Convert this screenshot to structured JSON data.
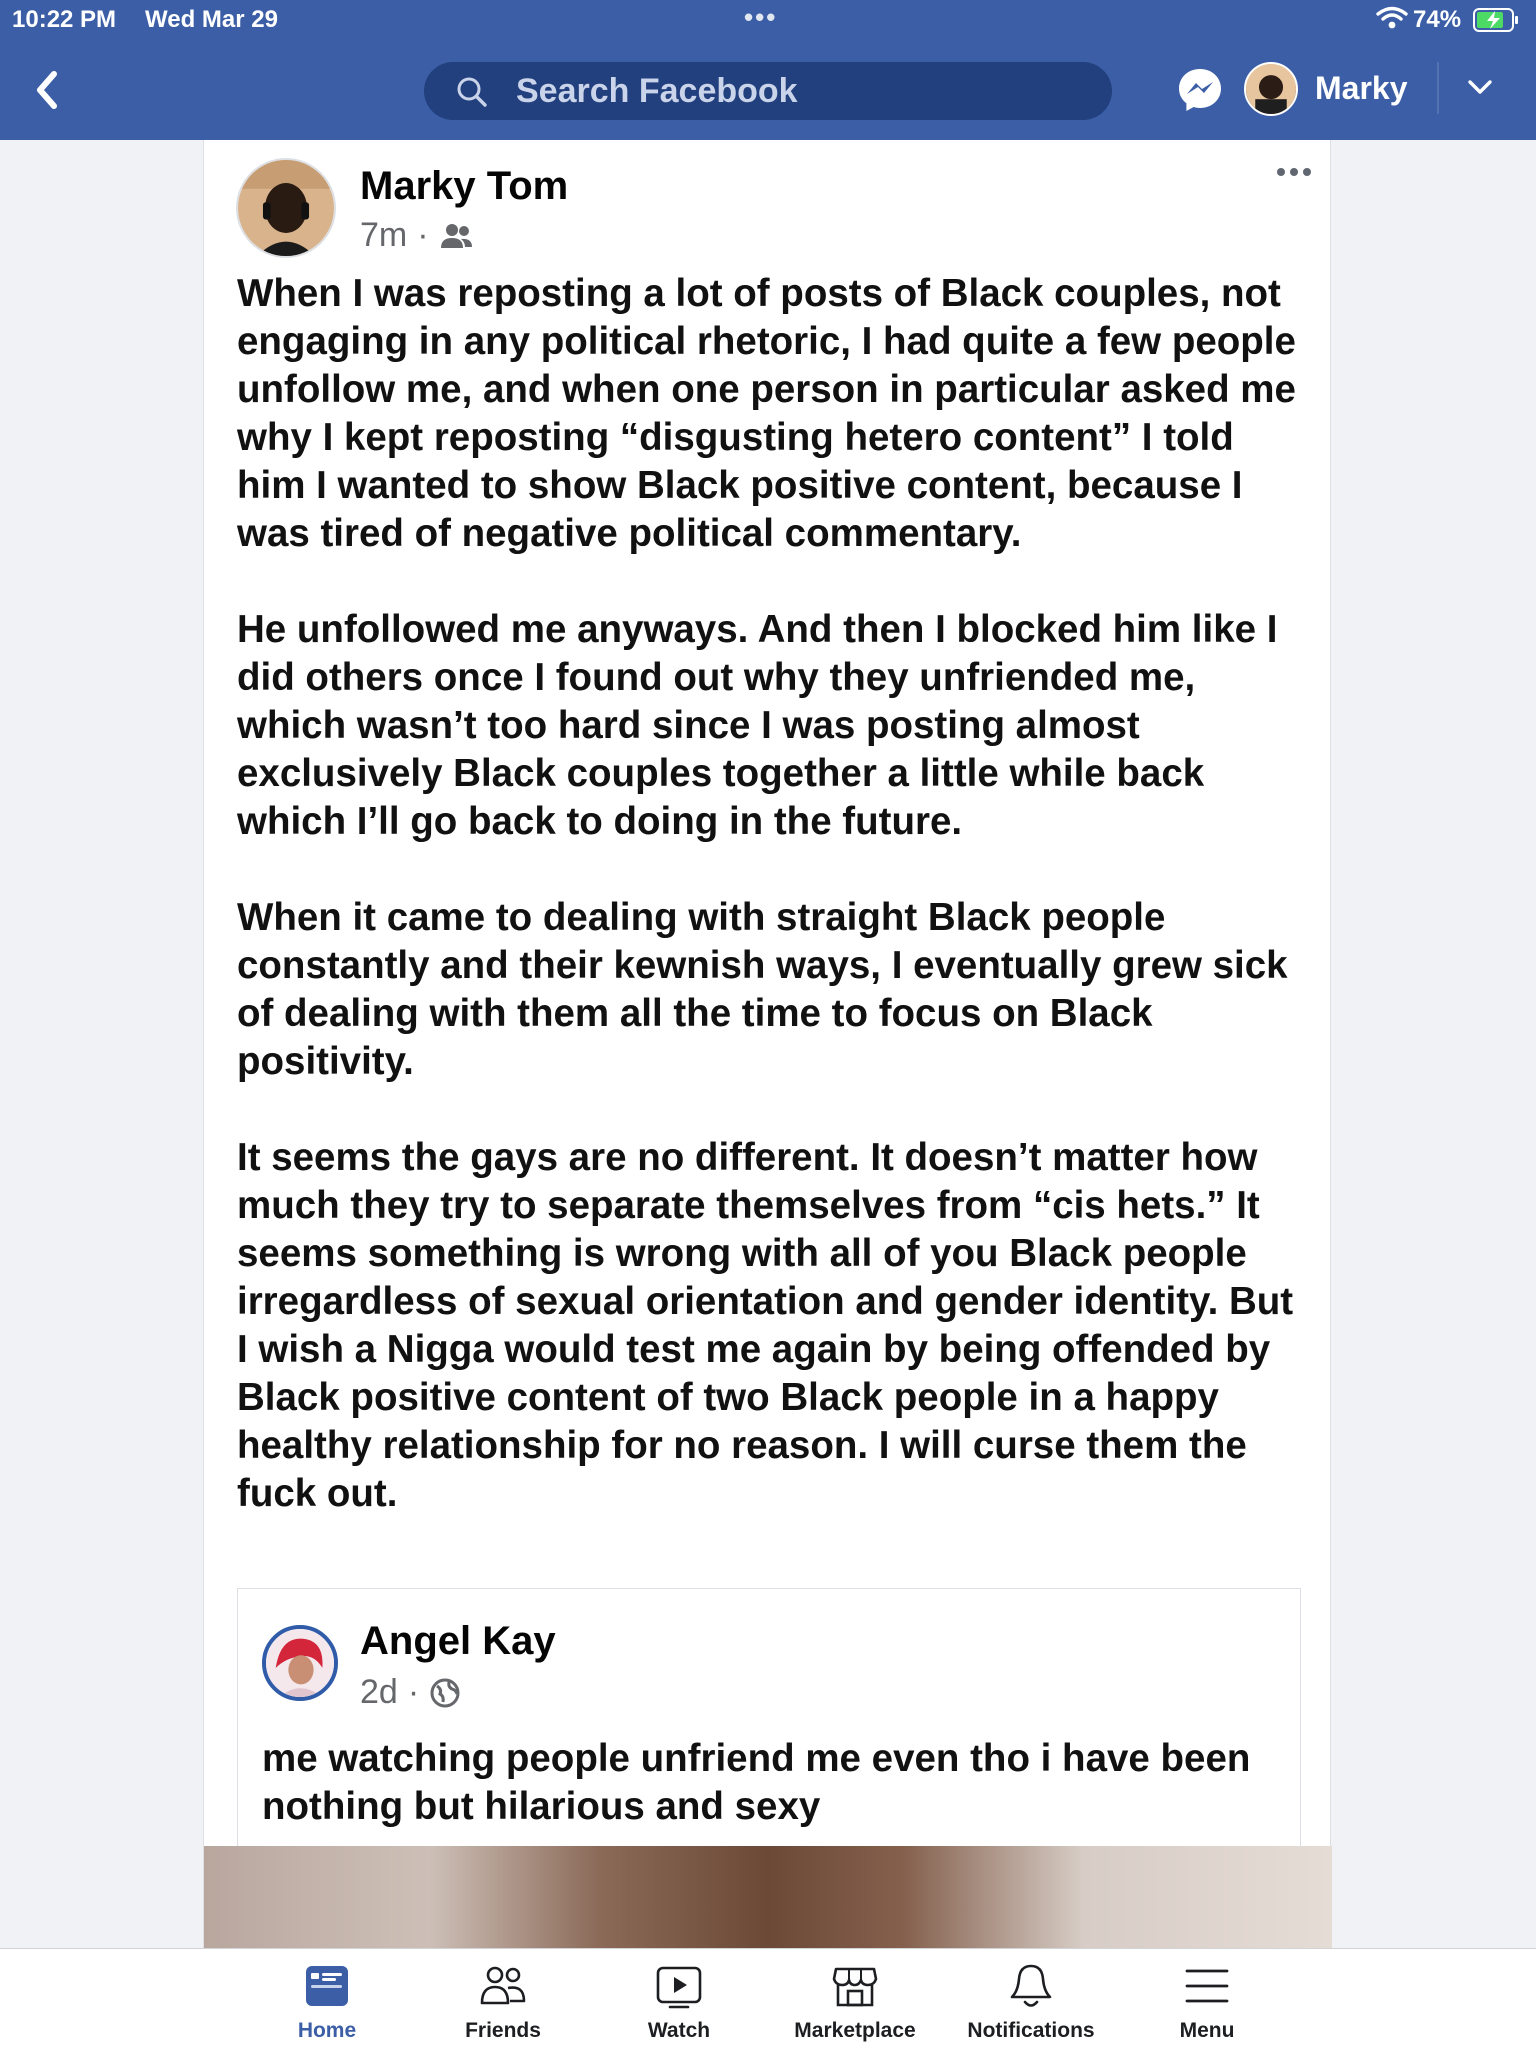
{
  "status_bar": {
    "time": "10:22 PM",
    "date": "Wed Mar 29",
    "battery": "74%"
  },
  "header": {
    "search_placeholder": "Search Facebook",
    "user_name": "Marky"
  },
  "post": {
    "author": "Marky Tom",
    "time": "7m",
    "separator": "·",
    "paragraphs": [
      "When I was reposting a lot of posts of Black couples, not engaging in any political rhetoric, I had quite a few people unfollow me, and when one person in particular asked me why I kept reposting “disgusting hetero content” I told him I wanted to show Black positive content, because I was tired of negative political commentary.",
      "He unfollowed me anyways. And then I blocked him like I did others once I found out why they unfriended me, which wasn’t too hard since I was posting almost exclusively Black couples together a little while back which I’ll go back to doing in the future.",
      "When it came to dealing with straight Black people constantly and their kewnish ways, I eventually grew sick of dealing with them  all the time to focus on Black positivity.",
      "It seems the gays are no different. It doesn’t matter how much they try to separate themselves from “cis hets.” It seems something is wrong with all of you Black people irregardless of sexual orientation and gender identity. But I wish a Nigga would test me again by being offended by Black positive content of two Black people in a happy healthy relationship for no reason. I will curse them the fuck out."
    ]
  },
  "shared_post": {
    "author": "Angel Kay",
    "time": "2d",
    "separator": "·",
    "text": "me watching people unfriend me even tho i have been nothing but hilarious and sexy"
  },
  "tabs": [
    {
      "label": "Home",
      "icon": "home-icon",
      "active": true
    },
    {
      "label": "Friends",
      "icon": "friends-icon",
      "active": false
    },
    {
      "label": "Watch",
      "icon": "watch-icon",
      "active": false
    },
    {
      "label": "Marketplace",
      "icon": "marketplace-icon",
      "active": false
    },
    {
      "label": "Notifications",
      "icon": "bell-icon",
      "active": false
    },
    {
      "label": "Menu",
      "icon": "menu-icon",
      "active": false
    }
  ],
  "colors": {
    "header_blue": "#3b5ea6",
    "search_bg": "#223f7e",
    "active_tab": "#3b5ea6"
  }
}
